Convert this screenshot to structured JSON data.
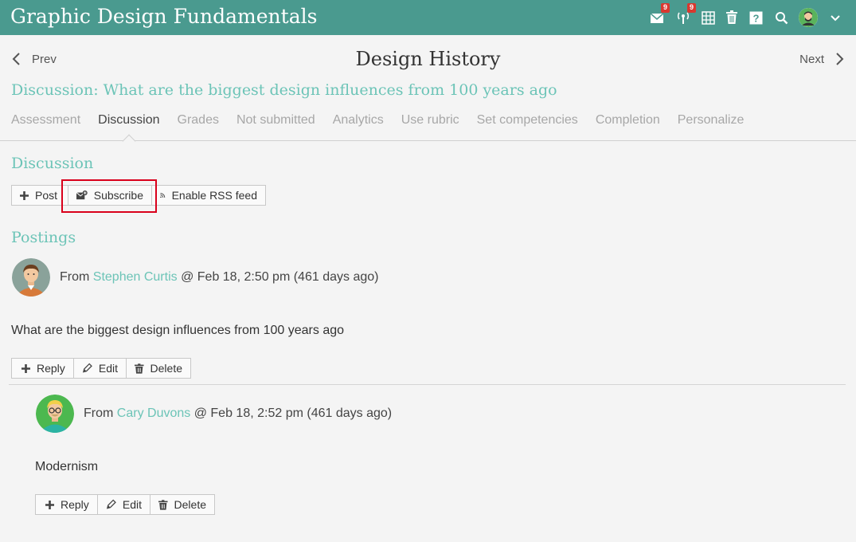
{
  "app": {
    "title": "Graphic Design Fundamentals",
    "mail_badge": "9",
    "alerts_badge": "9"
  },
  "nav": {
    "prev": "Prev",
    "page_title": "Design History",
    "next": "Next"
  },
  "discussion_title": "Discussion: What are the biggest design influences from 100 years ago",
  "tabs": [
    "Assessment",
    "Discussion",
    "Grades",
    "Not submitted",
    "Analytics",
    "Use rubric",
    "Set competencies",
    "Completion",
    "Personalize"
  ],
  "discussion_section": {
    "heading": "Discussion",
    "post_label": "Post",
    "subscribe_label": "Subscribe",
    "rss_label": "Enable RSS feed"
  },
  "postings": {
    "heading": "Postings",
    "items": [
      {
        "from": "From",
        "author": "Stephen Curtis",
        "timestamp": "@ Feb 18, 2:50 pm (461 days ago)",
        "body": "What are the biggest design influences from 100 years ago",
        "reply": "Reply",
        "edit": "Edit",
        "delete": "Delete"
      },
      {
        "from": "From",
        "author": "Cary Duvons",
        "timestamp": "@ Feb 18, 2:52 pm (461 days ago)",
        "body": "Modernism",
        "reply": "Reply",
        "edit": "Edit",
        "delete": "Delete"
      }
    ]
  },
  "colors": {
    "header_bg": "#4a9a8f",
    "accent": "#6cc4b7",
    "highlight": "#d9001b",
    "badge": "#d9382f"
  }
}
